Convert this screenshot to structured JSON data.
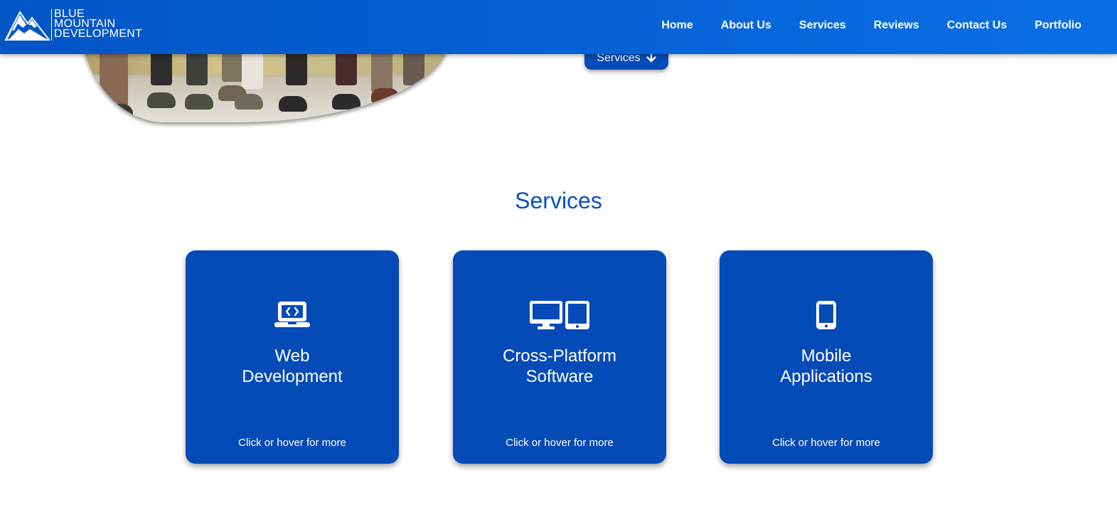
{
  "brand": {
    "line1": "BLUE",
    "line2": "MOUNTAIN",
    "line3": "DEVELOPMENT"
  },
  "nav": {
    "items": [
      {
        "label": "Home"
      },
      {
        "label": "About Us"
      },
      {
        "label": "Services"
      },
      {
        "label": "Reviews"
      },
      {
        "label": "Contact Us"
      },
      {
        "label": "Portfolio"
      }
    ]
  },
  "hero": {
    "button_label": "Services",
    "button_icon": "arrow-down-icon"
  },
  "services": {
    "title": "Services",
    "cards": [
      {
        "title_line1": "Web",
        "title_line2": "Development",
        "cta": "Click or hover for more",
        "icon": "laptop-code-icon"
      },
      {
        "title_line1": "Cross-Platform",
        "title_line2": "Software",
        "cta": "Click or hover for more",
        "icon": "desktop-tablet-icon"
      },
      {
        "title_line1": "Mobile",
        "title_line2": "Applications",
        "cta": "Click or hover for more",
        "icon": "mobile-phone-icon"
      }
    ]
  },
  "colors": {
    "primary": "#054bb8",
    "nav_start": "#0455c6",
    "nav_end": "#0a6fe4",
    "title": "#0a4fc0"
  }
}
